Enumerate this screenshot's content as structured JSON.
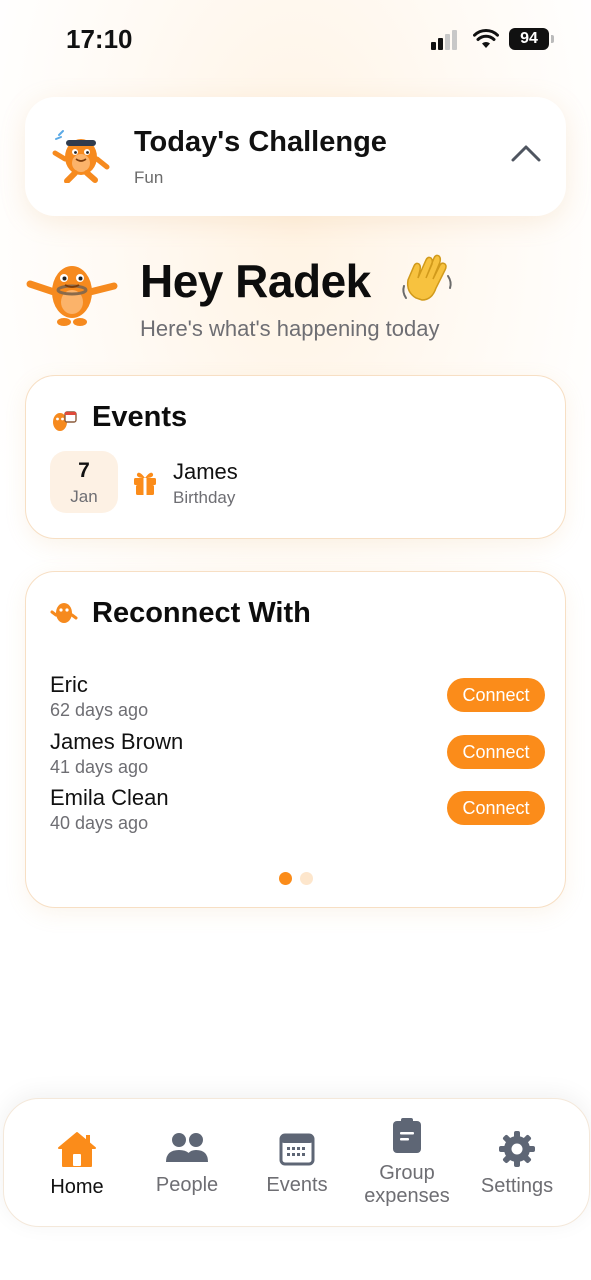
{
  "status_bar": {
    "time": "17:10",
    "battery": "94"
  },
  "challenge": {
    "title": "Today's Challenge",
    "subtitle": "Fun",
    "icon": "mascot-running-icon",
    "toggle_icon": "chevron-up-icon"
  },
  "greeting": {
    "title": "Hey Radek",
    "emoji": "👋",
    "subtitle": "Here's what's happening today"
  },
  "events": {
    "title": "Events",
    "items": [
      {
        "day": "7",
        "month": "Jan",
        "name": "James",
        "type": "Birthday",
        "icon": "gift-icon"
      }
    ]
  },
  "reconnect": {
    "title": "Reconnect With",
    "people": [
      {
        "name": "Eric",
        "last_seen": "62 days ago",
        "action": "Connect"
      },
      {
        "name": "James Brown",
        "last_seen": "41 days ago",
        "action": "Connect"
      },
      {
        "name": "Emila Clean",
        "last_seen": "40 days ago",
        "action": "Connect"
      }
    ],
    "page_count": 2,
    "current_page": 1
  },
  "tabs": [
    {
      "label": "Home",
      "icon": "home-icon",
      "active": true
    },
    {
      "label": "People",
      "icon": "people-icon",
      "active": false
    },
    {
      "label": "Events",
      "icon": "calendar-icon",
      "active": false
    },
    {
      "label": "Group expenses",
      "icon": "clipboard-icon",
      "active": false
    },
    {
      "label": "Settings",
      "icon": "gear-icon",
      "active": false
    }
  ],
  "colors": {
    "accent": "#fb8c1a",
    "accent_light": "#fde6cc",
    "muted_text": "#6e6e73",
    "card_border": "#f7dfc4"
  }
}
